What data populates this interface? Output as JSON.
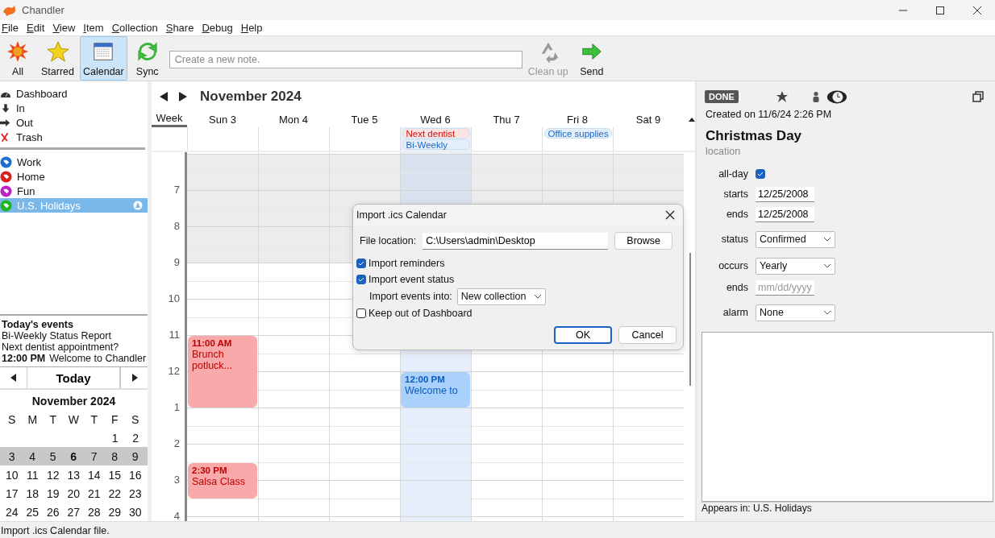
{
  "window": {
    "title": "Chandler"
  },
  "menu": [
    {
      "label": "File"
    },
    {
      "label": "Edit"
    },
    {
      "label": "View"
    },
    {
      "label": "Item"
    },
    {
      "label": "Collection"
    },
    {
      "label": "Share"
    },
    {
      "label": "Debug"
    },
    {
      "label": "Help"
    }
  ],
  "toolbar": [
    {
      "label": "All",
      "kind": "burst",
      "selected": false,
      "disabled": false
    },
    {
      "label": "Starred",
      "kind": "star",
      "selected": false,
      "disabled": false
    },
    {
      "label": "Calendar",
      "kind": "calendar",
      "selected": true,
      "disabled": false
    },
    {
      "label": "Sync",
      "kind": "sync",
      "selected": false,
      "disabled": false
    }
  ],
  "note_field": {
    "placeholder": "Create a new note."
  },
  "toolbar_right": [
    {
      "label": "Clean up",
      "kind": "recycle",
      "selected": false,
      "disabled": true
    },
    {
      "label": "Send",
      "kind": "send",
      "selected": false,
      "disabled": false
    }
  ],
  "sidebar": {
    "items": [
      {
        "label": "Dashboard",
        "kind": "dashboard"
      },
      {
        "label": "In",
        "kind": "in"
      },
      {
        "label": "Out",
        "kind": "out"
      },
      {
        "label": "Trash",
        "kind": "trash"
      }
    ],
    "collections": [
      {
        "label": "Work",
        "color": "#1e6fd0",
        "selected": false,
        "shared": false
      },
      {
        "label": "Home",
        "color": "#d82020",
        "selected": false,
        "shared": false
      },
      {
        "label": "Fun",
        "color": "#c020c8",
        "selected": false,
        "shared": false
      },
      {
        "label": "U.S. Holidays",
        "color": "#22b422",
        "selected": true,
        "shared": true
      }
    ]
  },
  "todays_events": {
    "title": "Today's events",
    "items": [
      {
        "title": "Bi-Weekly Status Report"
      },
      {
        "title": "Next dentist appointment?"
      },
      {
        "time": "12:00 PM",
        "title": "Welcome to Chandler"
      }
    ]
  },
  "mini_calendar": {
    "today_button": "Today",
    "title": "November 2024",
    "weekdays": [
      "S",
      "M",
      "T",
      "W",
      "T",
      "F",
      "S"
    ],
    "weeks": [
      {
        "kind": "first",
        "selected": false,
        "days": [
          {
            "d": "1",
            "today": false
          },
          {
            "d": "2",
            "today": false
          }
        ]
      },
      {
        "kind": "full",
        "selected": true,
        "days": [
          {
            "d": "3",
            "today": false
          },
          {
            "d": "4",
            "today": false
          },
          {
            "d": "5",
            "today": false
          },
          {
            "d": "6",
            "today": true
          },
          {
            "d": "7",
            "today": false
          },
          {
            "d": "8",
            "today": false
          },
          {
            "d": "9",
            "today": false
          }
        ]
      },
      {
        "kind": "full",
        "selected": false,
        "days": [
          {
            "d": "10",
            "today": false
          },
          {
            "d": "11",
            "today": false
          },
          {
            "d": "12",
            "today": false
          },
          {
            "d": "13",
            "today": false
          },
          {
            "d": "14",
            "today": false
          },
          {
            "d": "15",
            "today": false
          },
          {
            "d": "16",
            "today": false
          }
        ]
      },
      {
        "kind": "full",
        "selected": false,
        "days": [
          {
            "d": "17",
            "today": false
          },
          {
            "d": "18",
            "today": false
          },
          {
            "d": "19",
            "today": false
          },
          {
            "d": "20",
            "today": false
          },
          {
            "d": "21",
            "today": false
          },
          {
            "d": "22",
            "today": false
          },
          {
            "d": "23",
            "today": false
          }
        ]
      },
      {
        "kind": "full",
        "selected": false,
        "days": [
          {
            "d": "24",
            "today": false
          },
          {
            "d": "25",
            "today": false
          },
          {
            "d": "26",
            "today": false
          },
          {
            "d": "27",
            "today": false
          },
          {
            "d": "28",
            "today": false
          },
          {
            "d": "29",
            "today": false
          },
          {
            "d": "30",
            "today": false
          }
        ]
      }
    ]
  },
  "calendar": {
    "title": "November 2024",
    "view_tab": {
      "label": "Week",
      "selected": true
    },
    "days": [
      {
        "label": "Sun 3",
        "selected": false,
        "events": [
          {
            "time": "11:00 AM",
            "title": "Brunch potluck...",
            "kind": "long",
            "color": "#f9a9a9"
          },
          {
            "time": "2:30 PM",
            "title": "Salsa Class",
            "kind": "short",
            "color": "#f9a9a9"
          }
        ]
      },
      {
        "label": "Mon 4",
        "selected": false
      },
      {
        "label": "Tue 5",
        "selected": false
      },
      {
        "label": "Wed 6",
        "selected": true,
        "all_day": [
          {
            "title": "Next dentist",
            "color": "#fde4e4"
          },
          {
            "title": "Bi-Weekly",
            "color": "#e4effc"
          }
        ],
        "events": [
          {
            "time": "12:00 PM",
            "title": "Welcome to",
            "kind": "short",
            "color": "#a9d1fb"
          }
        ]
      },
      {
        "label": "Thu 7",
        "selected": false
      },
      {
        "label": "Fri 8",
        "selected": false,
        "all_day": [
          {
            "title": "Office supplies",
            "color": "#e4effc"
          }
        ]
      },
      {
        "label": "Sat 9",
        "selected": false
      }
    ],
    "hours": [
      {
        "label": "7",
        "shaded": true
      },
      {
        "label": "8",
        "shaded": true
      },
      {
        "label": "9",
        "shaded": false
      },
      {
        "label": "10",
        "shaded": false
      },
      {
        "label": "11",
        "shaded": false
      },
      {
        "label": "12",
        "shaded": false
      },
      {
        "label": "1",
        "shaded": false
      },
      {
        "label": "2",
        "shaded": false
      },
      {
        "label": "3",
        "shaded": false
      },
      {
        "label": "4",
        "shaded": false
      }
    ]
  },
  "dialog": {
    "title": "Import .ics Calendar",
    "file_label": "File location:",
    "file_value": "C:\\Users\\admin\\Desktop",
    "browse": "Browse",
    "options": [
      {
        "kind": "checkbox",
        "label": "Import reminders",
        "checked": true
      },
      {
        "kind": "checkbox",
        "label": "Import event status",
        "checked": true
      },
      {
        "kind": "select",
        "label": "Import events into:",
        "value": "New collection"
      },
      {
        "kind": "checkbox",
        "label": "Keep out of Dashboard",
        "checked": false
      }
    ],
    "buttons": [
      {
        "label": "OK",
        "default": true
      },
      {
        "label": "Cancel",
        "default": false
      }
    ]
  },
  "detail": {
    "badge": "DONE",
    "created": "Created on 11/6/24 2:26 PM",
    "title": "Christmas Day",
    "location": {
      "placeholder": "location"
    },
    "fields": [
      {
        "kind": "checkbox",
        "label": "all-day",
        "checked": true
      },
      {
        "kind": "date",
        "label": "starts",
        "value": "12/25/2008"
      },
      {
        "kind": "date",
        "label": "ends",
        "value": "12/25/2008"
      },
      {
        "kind": "select",
        "label": "status",
        "value": "Confirmed"
      },
      {
        "kind": "select",
        "label": "occurs",
        "value": "Yearly"
      },
      {
        "kind": "date",
        "label": "ends",
        "placeholder": "mm/dd/yyyy"
      },
      {
        "kind": "select",
        "label": "alarm",
        "value": "None"
      }
    ],
    "appears_in": "Appears in: U.S. Holidays"
  },
  "status_bar": {
    "text": "Import .ics Calendar file."
  }
}
